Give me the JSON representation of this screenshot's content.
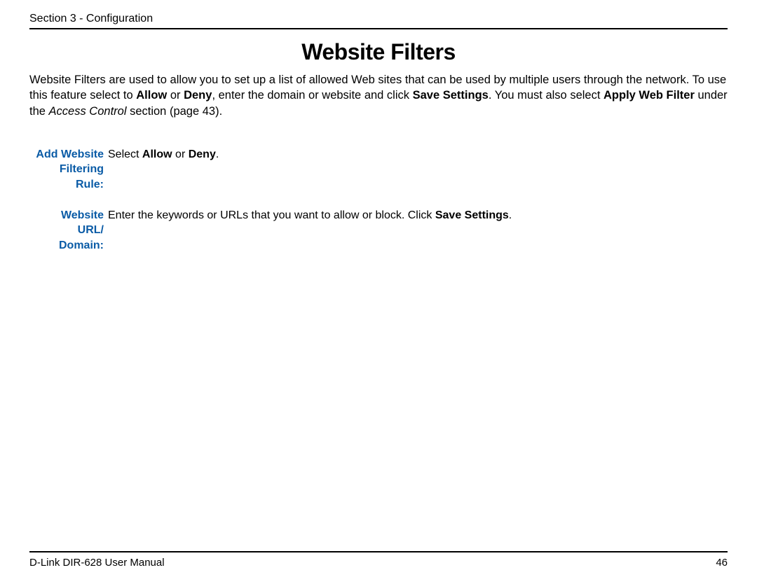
{
  "header": {
    "section_label": "Section 3 - Configuration"
  },
  "title": "Website Filters",
  "intro": {
    "t1": "Website Filters are used to allow you to set up a list of allowed Web sites that can be used by multiple users through the network. To use this feature select to ",
    "b1": "Allow",
    "t2": " or ",
    "b2": "Deny",
    "t3": ", enter the domain or website and click ",
    "b3": "Save Settings",
    "t4": ". You must also select ",
    "b4": "Apply Web Filter",
    "t5": " under the ",
    "i1": "Access Control",
    "t6": " section (page 43)."
  },
  "defs": {
    "row1": {
      "label_l1": "Add Website",
      "label_l2": "Filtering Rule:",
      "d1": "Select ",
      "db1": "Allow",
      "d2": " or ",
      "db2": "Deny",
      "d3": "."
    },
    "row2": {
      "label_l1": "Website URL/",
      "label_l2": "Domain:",
      "d1": "Enter the keywords or URLs that you want to allow or block. Click ",
      "db1": "Save Settings",
      "d2": "."
    }
  },
  "footer": {
    "manual": "D-Link DIR-628 User Manual",
    "page": "46"
  }
}
